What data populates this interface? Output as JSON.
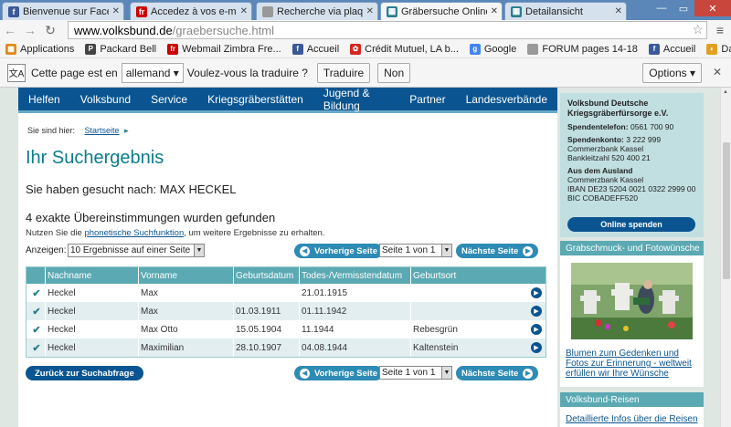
{
  "browser": {
    "tabs": [
      {
        "title": "Bienvenue sur Faceboo",
        "icon": "facebook-icon",
        "color": "#3b5998",
        "glyph": "f"
      },
      {
        "title": "Accedez à vos e-mails",
        "icon": "free-icon",
        "color": "#cc0000",
        "glyph": "fr"
      },
      {
        "title": "Recherche via plaque",
        "icon": "page-icon",
        "color": "#999999",
        "glyph": ""
      },
      {
        "title": "Gräbersuche Online",
        "icon": "volksbund-icon",
        "color": "#2a7f8c",
        "glyph": "▦"
      },
      {
        "title": "Detailansicht",
        "icon": "volksbund-icon",
        "color": "#2a7f8c",
        "glyph": "▦"
      }
    ],
    "url_host": "www.volksbund.de",
    "url_path": "/graebersuche.html",
    "bookmarks": [
      {
        "label": "Applications",
        "icon": "apps-icon",
        "color": "#e08a1e",
        "glyph": "▦"
      },
      {
        "label": "Packard Bell",
        "icon": "packard-bell-icon",
        "color": "#444444",
        "glyph": "P"
      },
      {
        "label": "Webmail Zimbra Fre...",
        "icon": "free-icon",
        "color": "#cc0000",
        "glyph": "fr"
      },
      {
        "label": "Accueil",
        "icon": "facebook-icon",
        "color": "#3b5998",
        "glyph": "f"
      },
      {
        "label": "Crédit Mutuel, LA b...",
        "icon": "credit-mutuel-icon",
        "color": "#d4261f",
        "glyph": "✿"
      },
      {
        "label": "Google",
        "icon": "google-icon",
        "color": "#4285f4",
        "glyph": "g"
      },
      {
        "label": "FORUM pages 14-18",
        "icon": "page-icon",
        "color": "#999999",
        "glyph": ""
      },
      {
        "label": "Accueil",
        "icon": "facebook-icon",
        "color": "#3b5998",
        "glyph": "f"
      },
      {
        "label": "Data Budget",
        "icon": "data-budget-icon",
        "color": "#e0a020",
        "glyph": "◐"
      }
    ],
    "translate": {
      "prefix": "Cette page est en",
      "language": "allemand",
      "question": "Voulez-vous la traduire ?",
      "translate_btn": "Traduire",
      "no_btn": "Non",
      "options_btn": "Options"
    }
  },
  "nav": [
    "Helfen",
    "Volksbund",
    "Service",
    "Kriegsgräberstätten",
    "Jugend & Bildung",
    "Partner",
    "Landesverbände"
  ],
  "breadcrumb": {
    "prefix": "Sie sind hier:",
    "link": "Startseite"
  },
  "title": "Ihr Suchergebnis",
  "searched": "Sie haben gesucht nach: MAX HECKEL",
  "found": "4 exakte Übereinstimmungen wurden gefunden",
  "hint": {
    "pre": "Nutzen Sie die ",
    "link": "phonetische Suchfunktion",
    "post": ", um weitere Ergebnisse zu erhalten."
  },
  "controls": {
    "show_label": "Anzeigen:",
    "show_value": "10 Ergebnisse auf einer Seite",
    "prev": "Vorherige Seite",
    "page": "Seite 1 von 1",
    "next": "Nächste Seite"
  },
  "table": {
    "headers": [
      "Nachname",
      "Vorname",
      "Geburtsdatum",
      "Todes-/Vermisstendatum",
      "Geburtsort"
    ],
    "rows": [
      [
        "Heckel",
        "Max",
        "",
        "21.01.1915",
        ""
      ],
      [
        "Heckel",
        "Max",
        "01.03.1911",
        "01.11.1942",
        ""
      ],
      [
        "Heckel",
        "Max Otto",
        "15.05.1904",
        "11.1944",
        "Rebesgrün"
      ],
      [
        "Heckel",
        "Maximilian",
        "28.10.1907",
        "04.08.1944",
        "Kaltenstein"
      ]
    ]
  },
  "back_btn": "Zurück zur Suchabfrage",
  "sidebar": {
    "org": "Volksbund Deutsche Kriegsgräberfürsorge e.V.",
    "phone_label": "Spendentelefon:",
    "phone": "0561 700 90",
    "account_label": "Spendenkonto:",
    "account": "3 222 999",
    "bank": "Commerzbank Kassel",
    "blz": "Bankleitzahl 520 400 21",
    "abroad_label": "Aus dem Ausland",
    "abroad_bank": "Commerzbank Kassel",
    "iban": "IBAN DE23 5204 0021 0322 2999 00",
    "bic": "BIC COBADEFF520",
    "donate_btn": "Online spenden",
    "section1": "Grabschmuck- und Fotowünsche",
    "section1_link": "Blumen zum Gedenken und Fotos zur Erinnerung - weltweit erfüllen wir Ihre Wünsche",
    "section2": "Volksbund-Reisen",
    "section2_link": "Detaillierte Infos über die Reisen"
  }
}
